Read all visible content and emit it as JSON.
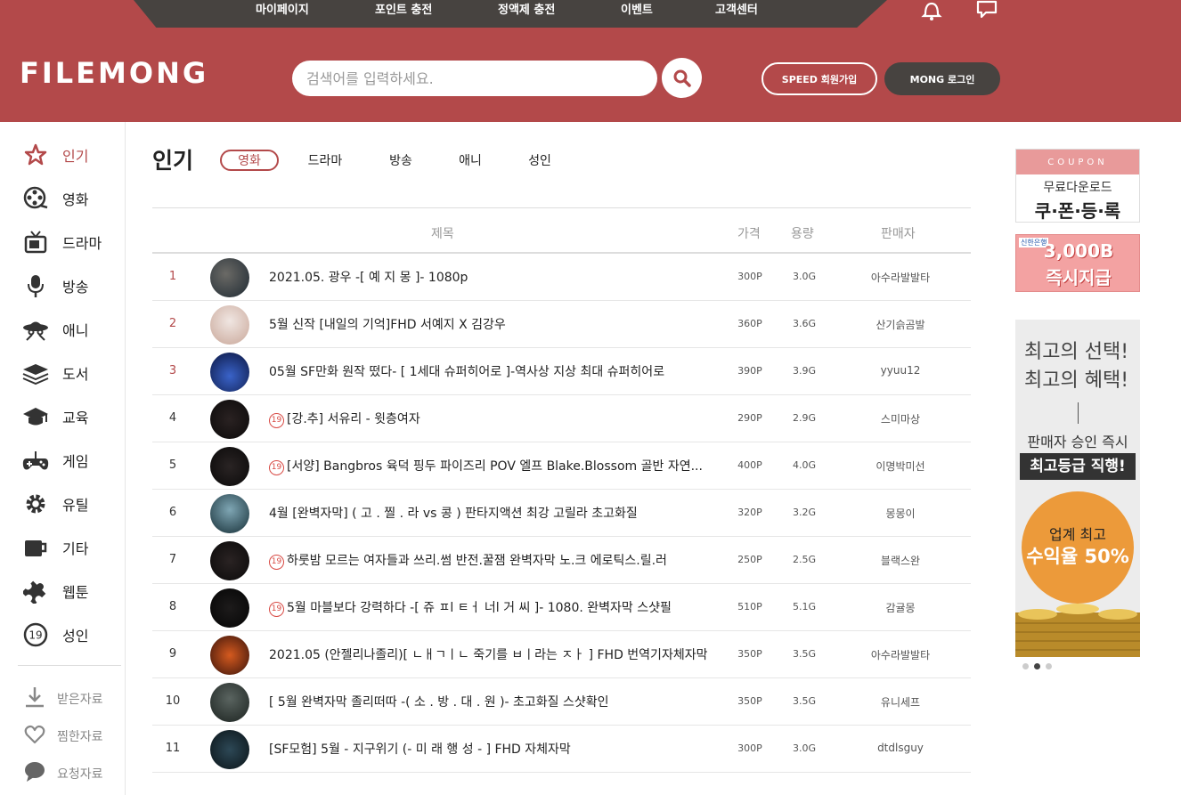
{
  "colors": {
    "brand": "#b3494a",
    "dark": "#474340",
    "adult": "#d84a44"
  },
  "topnav": {
    "items": [
      "마이페이지",
      "포인트 충전",
      "정액제 충전",
      "이벤트",
      "고객센터"
    ]
  },
  "header": {
    "logo": "FILEMONG",
    "search_placeholder": "검색어를 입력하세요.",
    "join_label": "SPEED 회원가입",
    "login_label": "MONG 로그인"
  },
  "sidebar": {
    "items": [
      {
        "label": "인기",
        "icon": "star-icon"
      },
      {
        "label": "영화",
        "icon": "film-reel-icon"
      },
      {
        "label": "드라마",
        "icon": "tv-icon"
      },
      {
        "label": "방송",
        "icon": "microphone-icon"
      },
      {
        "label": "애니",
        "icon": "ufo-icon"
      },
      {
        "label": "도서",
        "icon": "books-icon"
      },
      {
        "label": "교육",
        "icon": "graduation-cap-icon"
      },
      {
        "label": "게임",
        "icon": "gamepad-icon"
      },
      {
        "label": "유틸",
        "icon": "gear-icon"
      },
      {
        "label": "기타",
        "icon": "mug-icon"
      },
      {
        "label": "웹툰",
        "icon": "puzzle-icon"
      },
      {
        "label": "성인",
        "icon": "adult-19-icon"
      }
    ],
    "sub_items": [
      {
        "label": "받은자료",
        "icon": "download-icon"
      },
      {
        "label": "찜한자료",
        "icon": "heart-icon"
      },
      {
        "label": "요청자료",
        "icon": "speech-bubble-icon"
      }
    ]
  },
  "main": {
    "title": "인기",
    "tabs": [
      "영화",
      "드라마",
      "방송",
      "애니",
      "성인"
    ],
    "columns": {
      "title": "제목",
      "price": "가격",
      "size": "용량",
      "seller": "판매자"
    },
    "adult_badge": "19",
    "rows": [
      {
        "num": "1",
        "title": "2021.05. 광우 -[ 예 지 몽 ]- 1080p",
        "price": "300P",
        "size": "3.0G",
        "seller": "아수라발발타",
        "adult": false
      },
      {
        "num": "2",
        "title": "5월 신작 [내일의 기억]FHD 서예지 X 김강우",
        "price": "360P",
        "size": "3.6G",
        "seller": "산기슭곰발",
        "adult": false
      },
      {
        "num": "3",
        "title": "05월 SF만화 원작 떴다- [ 1세대 슈퍼히어로 ]-역사상 지상 최대 슈퍼히어로",
        "price": "390P",
        "size": "3.9G",
        "seller": "yyuu12",
        "adult": false
      },
      {
        "num": "4",
        "title": "[강.추] 서유리 - 윗층여자",
        "price": "290P",
        "size": "2.9G",
        "seller": "스미마상",
        "adult": true
      },
      {
        "num": "5",
        "title": "[서양] Bangbros 육덕 핑두 파이즈리 POV 엘프 Blake.Blossom 골반 자연...",
        "price": "400P",
        "size": "4.0G",
        "seller": "이명박미선",
        "adult": true
      },
      {
        "num": "6",
        "title": "4월 [완벽자막] ( 고 . 찔 . 라 vs 콩 ) 판타지액션 최강 고릴라 초고화질",
        "price": "320P",
        "size": "3.2G",
        "seller": "몽몽이",
        "adult": false
      },
      {
        "num": "7",
        "title": "하룻밤 모르는 여자들과 쓰리.썸 반전.꿀잼 완벽자막 노.크 에로틱스.릴.러",
        "price": "250P",
        "size": "2.5G",
        "seller": "블랙스완",
        "adult": true
      },
      {
        "num": "8",
        "title": "5월 마블보다 강력하다 -[ 쥬 ㅍl ㅌㅓ 너l 거 씨 ]- 1080. 완벽자막 스샷필",
        "price": "510P",
        "size": "5.1G",
        "seller": "감귤몽",
        "adult": true
      },
      {
        "num": "9",
        "title": "2021.05 (안젤리나졸리)[ ㄴㅐㄱㅣㄴ 죽기를 ㅂㅣ라는 ㅈㅏ ] FHD 번역기자체자막",
        "price": "350P",
        "size": "3.5G",
        "seller": "아수라발발타",
        "adult": false
      },
      {
        "num": "10",
        "title": "[ 5월 완벽자막 졸리떠따 -( 소 . 방 . 대 . 원 )- 초고화질 스샷확인",
        "price": "350P",
        "size": "3.5G",
        "seller": "유니세프",
        "adult": false
      },
      {
        "num": "11",
        "title": "[SF모험] 5월 - 지구위기 (- 미 래 행 성 - ] FHD 자체자막",
        "price": "300P",
        "size": "3.0G",
        "seller": "dtdlsguy",
        "adult": false
      }
    ]
  },
  "ads": {
    "coupon_band": "COUPON",
    "coupon_line1": "무료다운로드",
    "coupon_line2": "쿠·폰·등·록",
    "bank_logo": "신한은행",
    "bank_line1": "3,000B",
    "bank_line2": "즉시지급",
    "promo_line1": "최고의 선택!",
    "promo_line2": "최고의 혜택!",
    "promo_line3": "판매자 승인 즉시",
    "promo_line4": "최고등급 직행!",
    "promo_circle1": "업계 최고",
    "promo_circle2": "수익율 50%"
  }
}
